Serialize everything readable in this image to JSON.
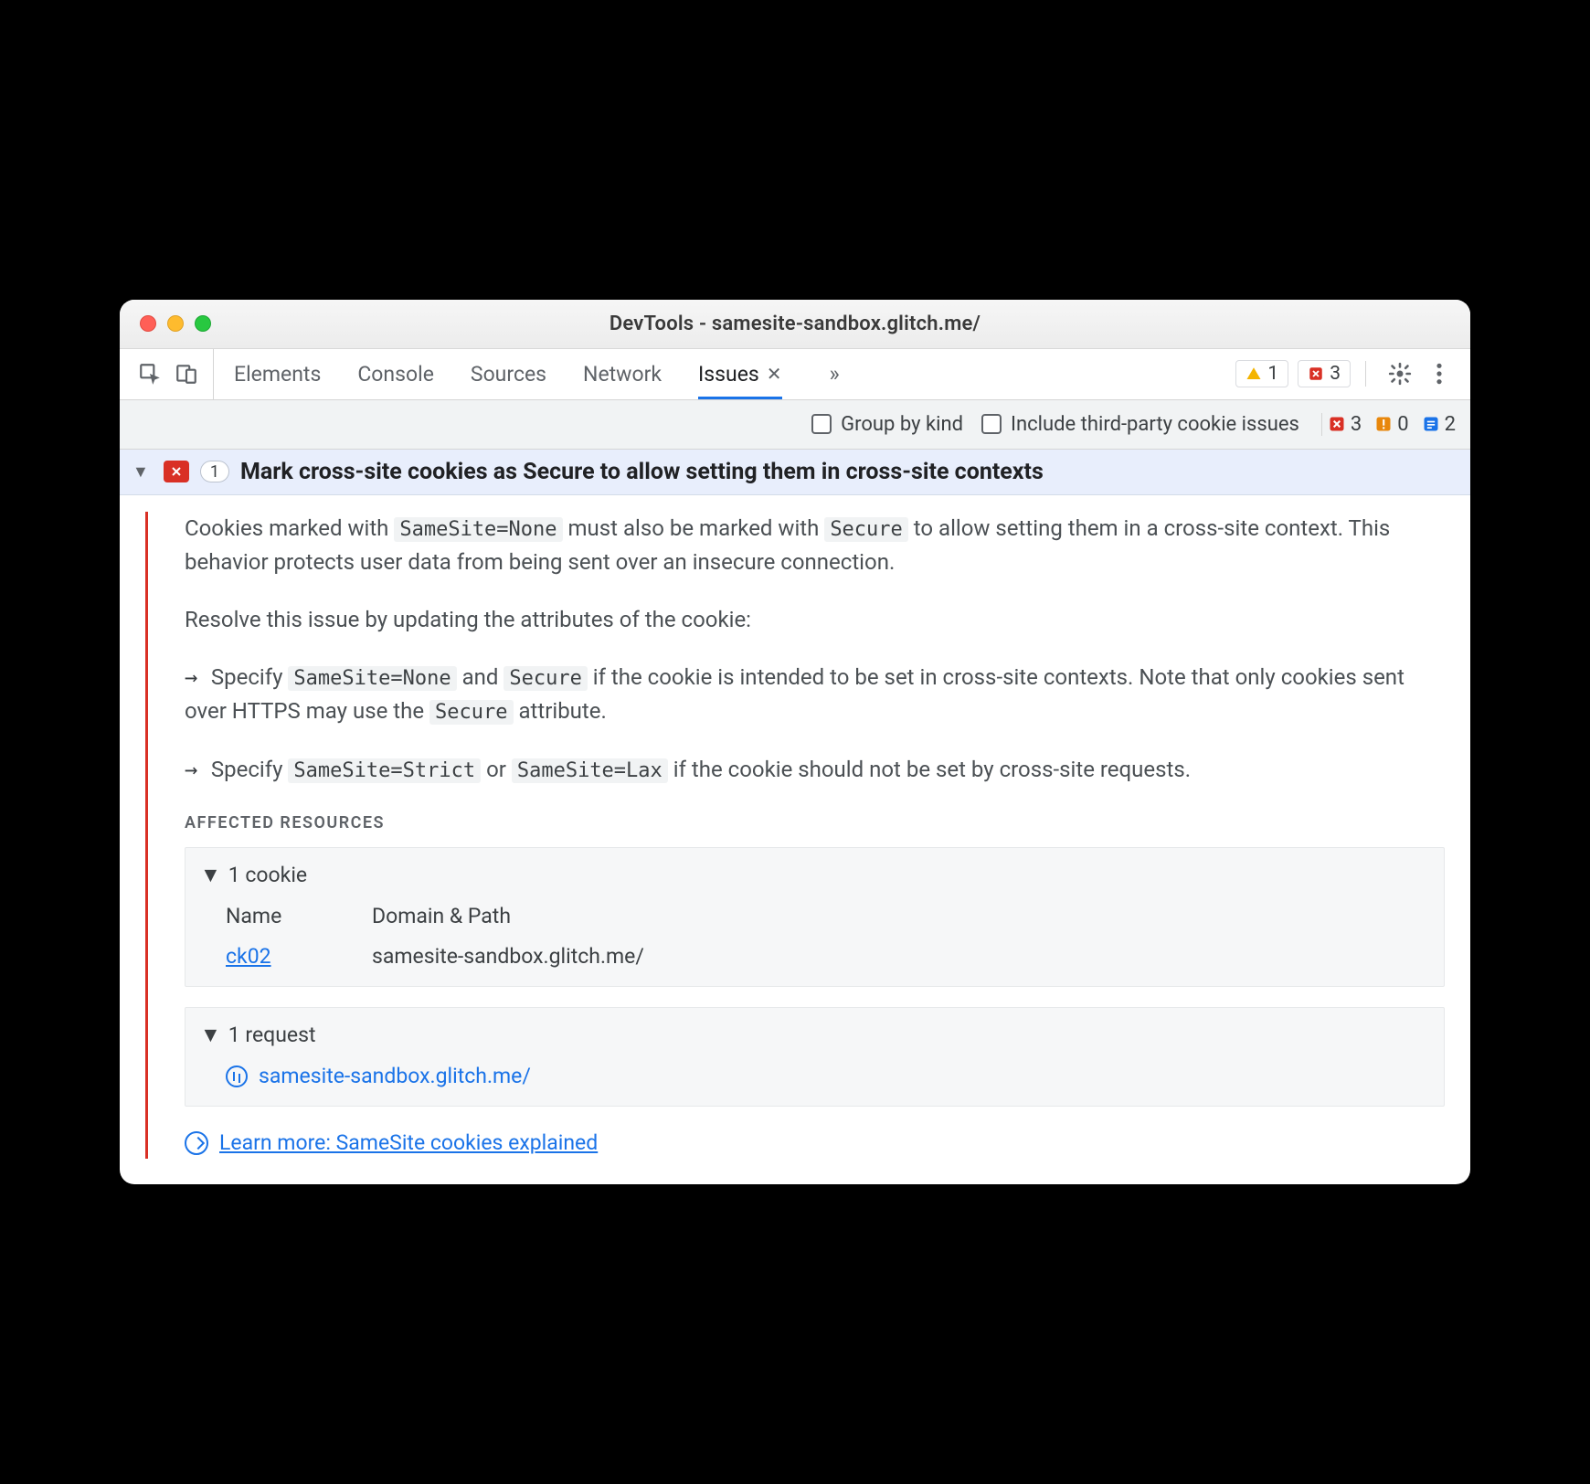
{
  "window": {
    "title": "DevTools - samesite-sandbox.glitch.me/"
  },
  "tabs": {
    "items": [
      "Elements",
      "Console",
      "Sources",
      "Network",
      "Issues"
    ],
    "active_index": 4,
    "warning_count": "1",
    "error_count": "3"
  },
  "filterbar": {
    "group_label": "Group by kind",
    "include_label": "Include third-party cookie issues",
    "counts": {
      "error": "3",
      "warn": "0",
      "info": "2"
    }
  },
  "issue": {
    "count": "1",
    "title": "Mark cross-site cookies as Secure to allow setting them in cross-site contexts",
    "desc_parts": {
      "p1a": "Cookies marked with ",
      "p1b": " must also be marked with ",
      "p1c": " to allow setting them in a cross-site context. This behavior protects user data from being sent over an insecure connection.",
      "code_none": "SameSite=None",
      "code_secure": "Secure",
      "p2": "Resolve this issue by updating the attributes of the cookie:",
      "b1a": "Specify ",
      "b1b": " and ",
      "b1c": " if the cookie is intended to be set in cross-site contexts. Note that only cookies sent over HTTPS may use the ",
      "b1d": " attribute.",
      "b2a": "Specify ",
      "code_strict": "SameSite=Strict",
      "b2b": " or ",
      "code_lax": "SameSite=Lax",
      "b2c": " if the cookie should not be set by cross-site requests."
    },
    "affected_label": "AFFECTED RESOURCES",
    "cookie_section": {
      "summary": "1 cookie",
      "col_name": "Name",
      "col_domain": "Domain & Path",
      "row_name": "ck02",
      "row_domain": "samesite-sandbox.glitch.me/"
    },
    "request_section": {
      "summary": "1 request",
      "url": "samesite-sandbox.glitch.me/"
    },
    "learn_more": "Learn more: SameSite cookies explained"
  }
}
